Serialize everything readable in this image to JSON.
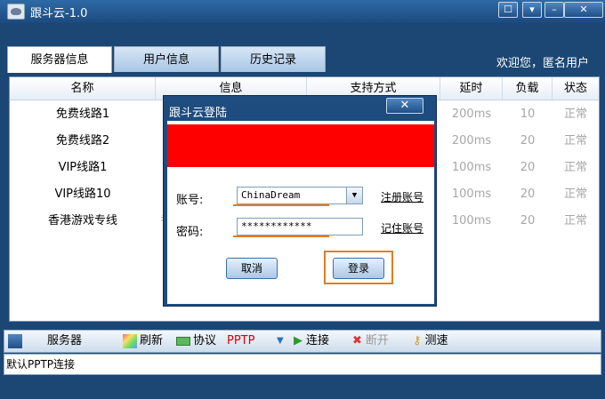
{
  "window": {
    "title": "跟斗云-1.0"
  },
  "tabs": [
    "服务器信息",
    "用户信息",
    "历史记录"
  ],
  "welcome": "欢迎您，匿名用户",
  "table": {
    "headers": [
      "名称",
      "信息",
      "支持方式",
      "延时",
      "负载",
      "状态"
    ],
    "rows": [
      {
        "name": "免费线路1",
        "info": "",
        "latency": "200ms",
        "load": "10",
        "status": "正常"
      },
      {
        "name": "免费线路2",
        "info": "",
        "latency": "200ms",
        "load": "20",
        "status": "正常"
      },
      {
        "name": "VIP线路1",
        "info": "",
        "latency": "100ms",
        "load": "20",
        "status": "正常"
      },
      {
        "name": "VIP线路10",
        "info": "",
        "latency": "100ms",
        "load": "20",
        "status": "正常"
      },
      {
        "name": "香港游戏专线",
        "info": "香",
        "latency": "100ms",
        "load": "20",
        "status": "正常"
      }
    ]
  },
  "toolbar": {
    "server_label": "服务器",
    "refresh": "刷新",
    "protocol": "协议",
    "protocol_value": "PPTP",
    "connect": "连接",
    "disconnect": "断开",
    "speedtest": "测速"
  },
  "status_bar": "默认PPTP连接",
  "login_dialog": {
    "title": "跟斗云登陆",
    "account_label": "账号:",
    "account_value": "ChinaDream",
    "password_label": "密码:",
    "password_value": "************",
    "register_link": "注册账号",
    "forgot_link": "记住账号",
    "cancel": "取消",
    "login": "登录",
    "banner_color": "#ff0000",
    "highlight_color": "#e57c1f"
  }
}
